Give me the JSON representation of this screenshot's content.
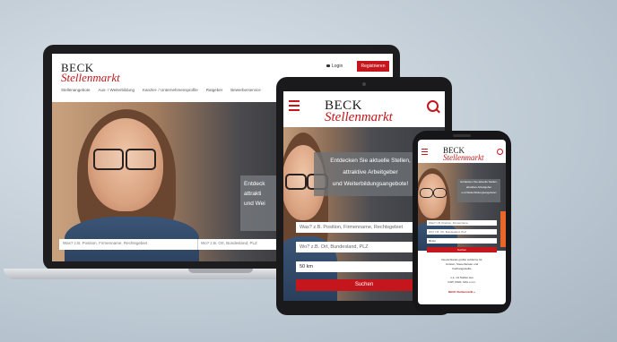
{
  "brand": {
    "line1": "BECK",
    "line2": "Stellenmarkt",
    "red": "#c4161c"
  },
  "laptop": {
    "login": "Login",
    "register": "Registrieren",
    "nav": [
      "Stellenangebote",
      "Aus- / Weiterbildung",
      "Kanzlei- / Unternehmensprofile",
      "Ratgeber",
      "Bewerberservice"
    ],
    "overlay": "Entdeck\nattrakti\nund Wei",
    "search_what": "Was? z.B. Position, Firmenname, Rechtsgebiet",
    "search_where": "Wo? z.B. Ort, Bundesland, PLZ"
  },
  "tablet": {
    "overlay": "Entdecken Sie aktuelle Stellen,\nattraktive Arbeitgeber\nund Weiterbildungsangebote!",
    "search_what": "Was? z.B. Position, Firmenname, Rechtsgebiet",
    "search_where": "Wo? z.B. Ort, Bundesland, PLZ",
    "radius": "50 km",
    "search_button": "Suchen"
  },
  "phone": {
    "overlay": "Entdecken Sie aktuelle Stellen,\nattraktive Arbeitgeber\nund Weiterbildungsangebote!",
    "search_what": "Was? z.B. Position, Firmenname",
    "search_where": "Wo? z.B. Ort, Bundesland, PLZ",
    "radius": "50 km",
    "search_button": "Suchen",
    "text1": "Deutschlands größte Jobbörse für\nJuristen, Steuerberater und\nFachangestellte",
    "text2": "u.a. mit Stellen aus\nNJW, DStR, NZA u.v.m.",
    "text3": "BECK Stellenmarkt »"
  }
}
